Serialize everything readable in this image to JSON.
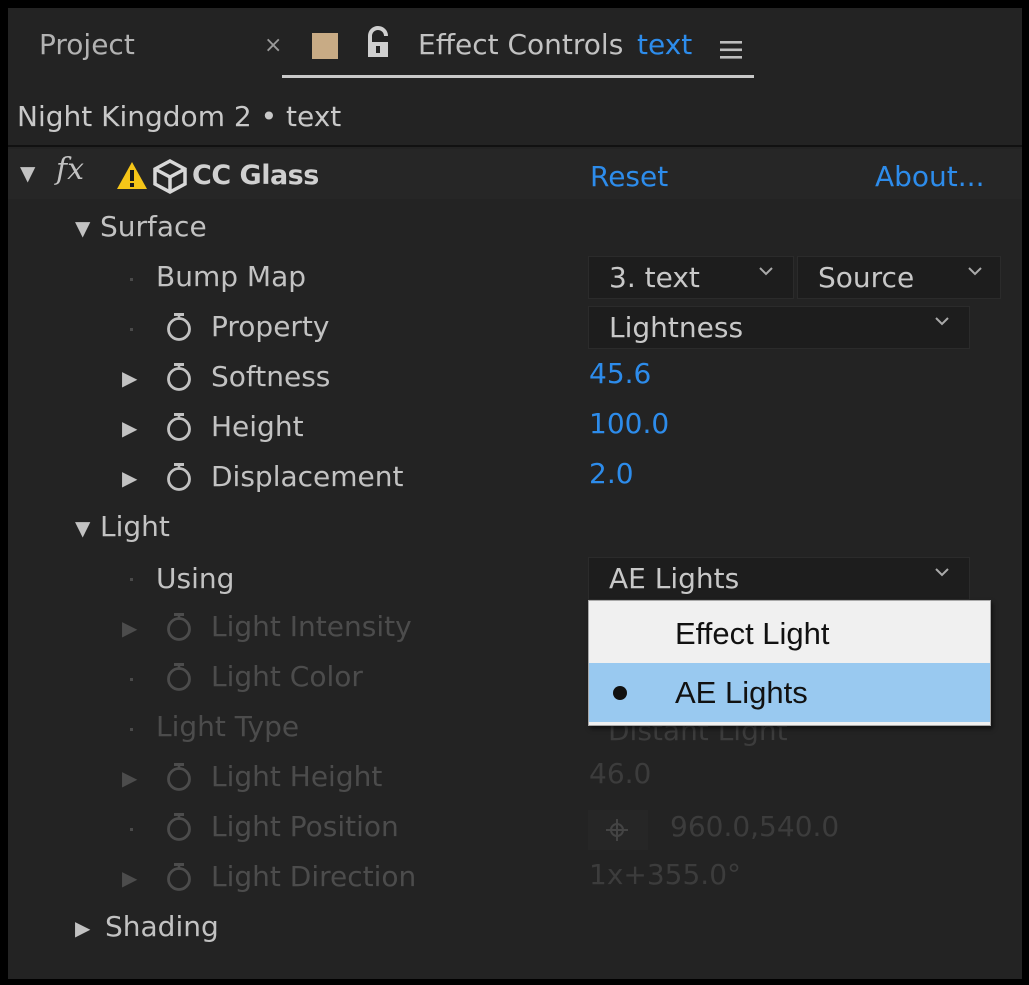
{
  "tabs": {
    "project_label": "Project",
    "close_glyph": "×",
    "effect_controls_label": "Effect Controls",
    "layer_name": "text",
    "menu_glyph": "≡",
    "lock_icon": "lock-icon",
    "color_swatch": "#c8ab85"
  },
  "composition": {
    "path": "Night Kingdom 2 • text"
  },
  "effect": {
    "fx_glyph": "fx",
    "name": "CC Glass",
    "reset_label": "Reset",
    "about_label": "About...",
    "warning_color": "#f5c518"
  },
  "surface": {
    "group_label": "Surface",
    "bump_map_label": "Bump Map",
    "bump_map_layer": "3. text",
    "bump_map_source": "Source",
    "property_label": "Property",
    "property_value": "Lightness",
    "softness_label": "Softness",
    "softness_value": "45.6",
    "height_label": "Height",
    "height_value": "100.0",
    "displacement_label": "Displacement",
    "displacement_value": "2.0"
  },
  "light": {
    "group_label": "Light",
    "using_label": "Using",
    "using_value": "AE Lights",
    "intensity_label": "Light Intensity",
    "color_label": "Light Color",
    "type_label": "Light Type",
    "type_value": "Distant Light",
    "height_label": "Light Height",
    "height_value": "46.0",
    "position_label": "Light Position",
    "position_value": "960.0,540.0",
    "direction_label": "Light Direction",
    "direction_value": "1x+355.0°"
  },
  "shading": {
    "group_label": "Shading"
  },
  "popup": {
    "options": [
      "Effect Light",
      "AE Lights"
    ],
    "selected": "AE Lights"
  },
  "colors": {
    "panel_bg": "#232323",
    "value_blue": "#2d8ceb",
    "selection": "#99c9f0"
  }
}
